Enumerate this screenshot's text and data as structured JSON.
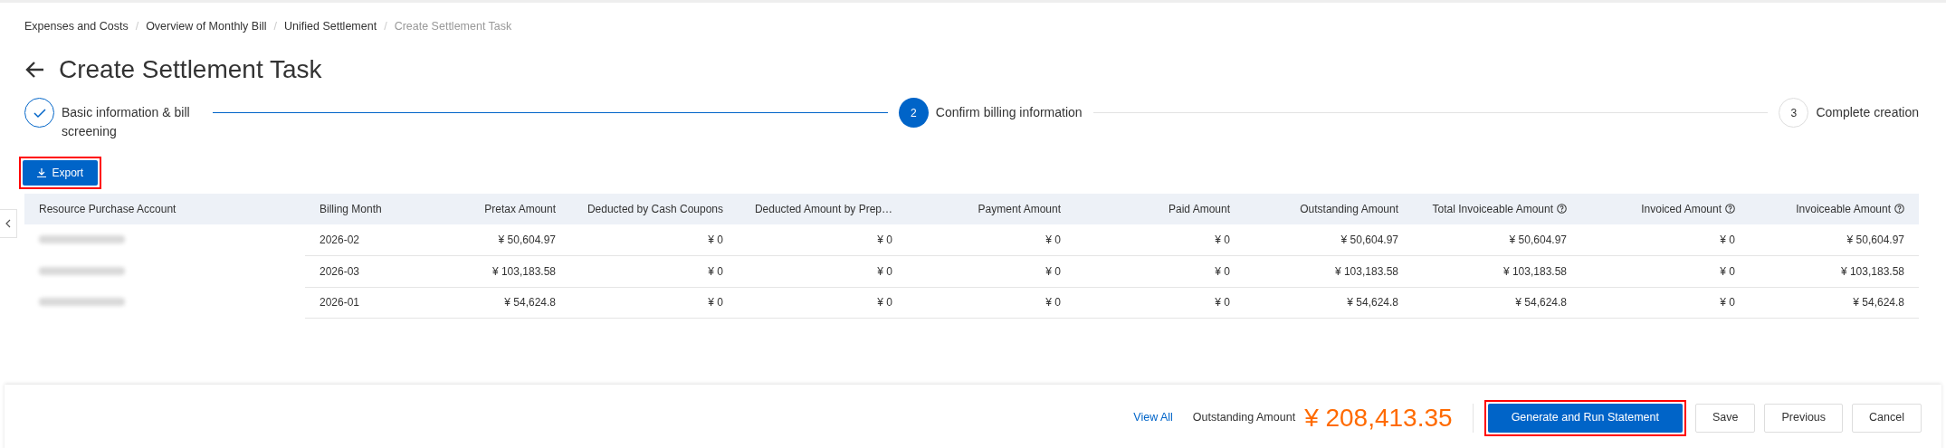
{
  "breadcrumb": [
    {
      "label": "Expenses and Costs",
      "current": false
    },
    {
      "separator": "/",
      "label": "Overview of Monthly Bill",
      "current": false
    },
    {
      "separator": "/",
      "label": "Unified Settlement",
      "current": false
    },
    {
      "separator": "/",
      "label": "Create Settlement Task",
      "current": true
    }
  ],
  "title": "Create Settlement Task",
  "steps": [
    {
      "label": "Basic information & bill screening",
      "done": true,
      "selected": false
    },
    {
      "number": "2",
      "label": "Confirm billing information",
      "done": false,
      "selected": true
    },
    {
      "number": "3",
      "label": "Complete creation",
      "done": false,
      "selected": false
    }
  ],
  "export_button": {
    "label": "Export",
    "highlighted": true
  },
  "table": {
    "columns": [
      {
        "label": "Resource Purchase Account",
        "help": false
      },
      {
        "label": "Billing Month",
        "help": false
      },
      {
        "label": "Pretax Amount",
        "help": false
      },
      {
        "label": "Deducted by Cash Coupons",
        "help": false
      },
      {
        "label": "Deducted Amount by Prep…",
        "help": false
      },
      {
        "label": "Payment Amount",
        "help": false
      },
      {
        "label": "Paid Amount",
        "help": false
      },
      {
        "label": "Outstanding Amount",
        "help": false
      },
      {
        "label": "Total Invoiceable Amount",
        "help": true
      },
      {
        "label": "Invoiced Amount",
        "help": true
      },
      {
        "label": "Invoiceable Amount",
        "help": true
      }
    ],
    "rows": [
      {
        "account_redacted": true,
        "cells": [
          "",
          "2026-02",
          "¥ 50,604.97",
          "¥ 0",
          "¥ 0",
          "¥ 0",
          "¥ 0",
          "¥ 50,604.97",
          "¥ 50,604.97",
          "¥ 0",
          "¥ 50,604.97"
        ]
      },
      {
        "account_redacted": true,
        "cells": [
          "",
          "2026-03",
          "¥ 103,183.58",
          "¥ 0",
          "¥ 0",
          "¥ 0",
          "¥ 0",
          "¥ 103,183.58",
          "¥ 103,183.58",
          "¥ 0",
          "¥ 103,183.58"
        ]
      },
      {
        "account_redacted": true,
        "cells": [
          "",
          "2026-01",
          "¥ 54,624.8",
          "¥ 0",
          "¥ 0",
          "¥ 0",
          "¥ 0",
          "¥ 54,624.8",
          "¥ 54,624.8",
          "¥ 0",
          "¥ 54,624.8"
        ]
      }
    ]
  },
  "footer": {
    "view_all": "View All",
    "outstanding_label": "Outstanding Amount",
    "outstanding_amount": "¥ 208,413.35",
    "buttons": [
      {
        "label": "Generate and Run Statement",
        "kind": "primary",
        "highlighted": true
      },
      {
        "label": "Save",
        "kind": "secondary",
        "highlighted": false
      },
      {
        "label": "Previous",
        "kind": "secondary",
        "highlighted": false
      },
      {
        "label": "Cancel",
        "kind": "secondary",
        "highlighted": false
      }
    ]
  }
}
